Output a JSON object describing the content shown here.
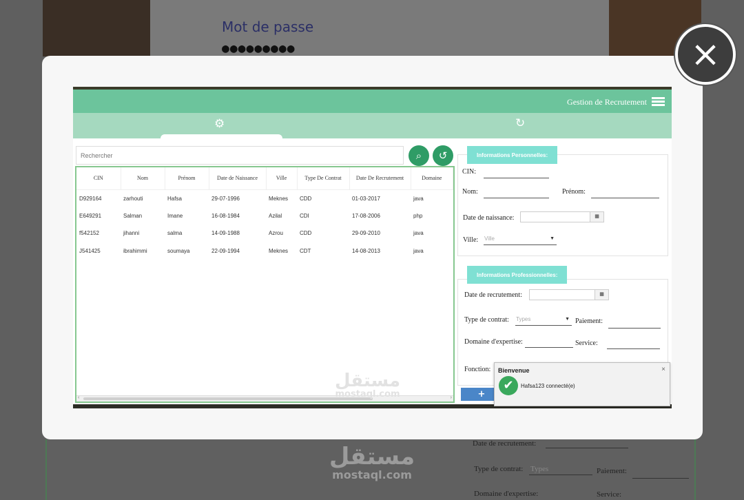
{
  "background": {
    "password_label": "Mot de passe",
    "password_value": "●●●●●●●●●",
    "lower_form": {
      "date_recrutement": "Date de recrutement:",
      "type_contrat": "Type de contrat:",
      "types_placeholder": "Types",
      "paiement": "Paiement:",
      "domaine": "Domaine d'expertise:",
      "service": "Service:"
    },
    "watermark": {
      "arabic": "مستقل",
      "latin": "mostaql.com"
    }
  },
  "close_button": {
    "icon": "close-icon",
    "label": "×"
  },
  "app": {
    "title": "Gestion de Recrutement",
    "menu_icon": "hamburger-icon",
    "tabs": [
      {
        "icon": "gears-icon",
        "glyph": "⚙",
        "active": true
      },
      {
        "icon": "history-icon",
        "glyph": "↻",
        "active": false
      }
    ],
    "search": {
      "placeholder": "Rechercher",
      "search_icon": "search-icon",
      "refresh_icon": "refresh-icon"
    },
    "table": {
      "columns": [
        "CIN",
        "Nom",
        "Prénom",
        "Date de Naissance",
        "Ville",
        "Type De Contrat",
        "Date De Recrutement",
        "Domaine"
      ],
      "rows": [
        [
          "D929164",
          "zarhouti",
          "Hafsa",
          "29-07-1996",
          "Meknes",
          "CDD",
          "01-03-2017",
          "java"
        ],
        [
          "E649291",
          "Salman",
          "Imane",
          "16-08-1984",
          "Azilal",
          "CDI",
          "17-08-2006",
          "php"
        ],
        [
          "f542152",
          "jihanni",
          "salma",
          "14-09-1988",
          "Azrou",
          "CDD",
          "29-09-2010",
          "java"
        ],
        [
          "J541425",
          "ibrahimmi",
          "soumaya",
          "22-09-1994",
          "Meknes",
          "CDT",
          "14-08-2013",
          "java"
        ]
      ]
    },
    "personal": {
      "badge": "Informations Personnelles:",
      "cin": "CIN:",
      "nom": "Nom:",
      "prenom": "Prénom:",
      "date_naissance": "Date de naissance:",
      "ville": "Ville:",
      "ville_placeholder": "Ville"
    },
    "professional": {
      "badge": "Informations Professionnelles:",
      "date_recrutement": "Date de recrutement:",
      "type_contrat": "Type de contrat:",
      "types_placeholder": "Types",
      "paiement": "Paiement:",
      "domaine": "Domaine d'expertise:",
      "service": "Service:",
      "fonction": "Fonction:"
    },
    "add_button": "+",
    "calendar_glyph": "▦",
    "inner_watermark": {
      "arabic": "مستقل",
      "latin": "mostaql.com"
    }
  },
  "toast": {
    "title": "Bienvenue",
    "message": "Hafsa123 connecté(e)",
    "check_icon": "check-icon",
    "close": "×"
  }
}
